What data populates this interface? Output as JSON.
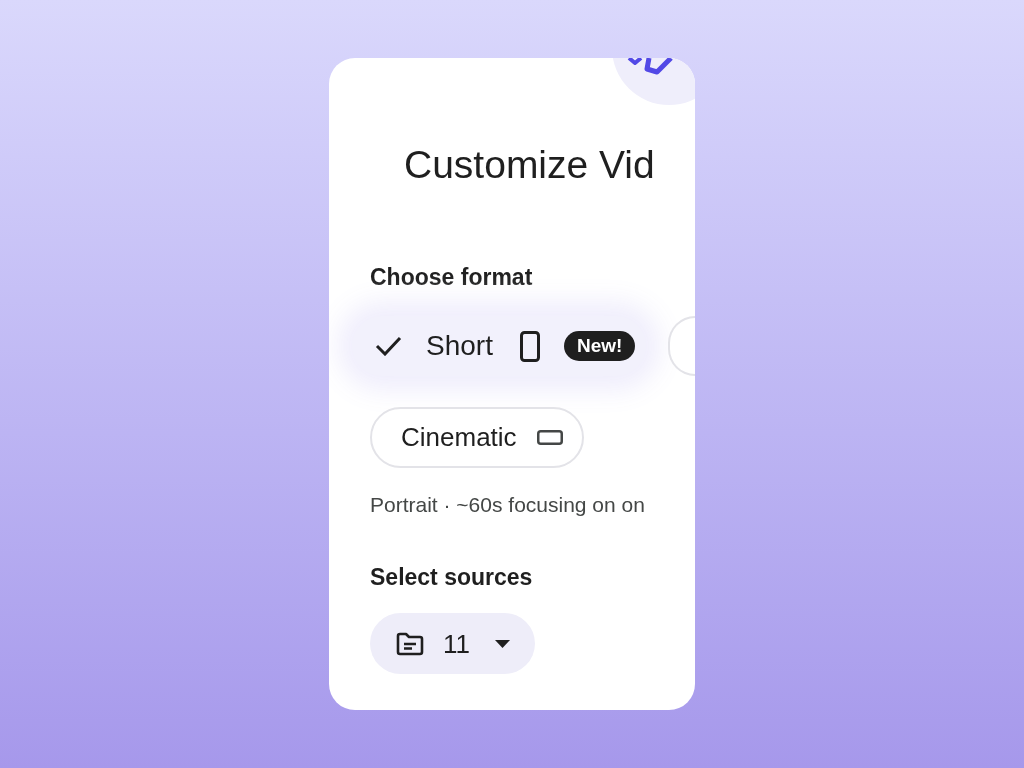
{
  "dialog": {
    "title": "Customize Vid"
  },
  "format_section": {
    "heading": "Choose format",
    "options": [
      {
        "label": "Short",
        "selected": true,
        "kind": "portrait",
        "badge": "New!"
      },
      {
        "selected": false
      },
      {
        "label": "Cinematic",
        "selected": false,
        "kind": "landscape"
      }
    ],
    "description": "Portrait · ~60s focusing on on"
  },
  "sources_section": {
    "heading": "Select sources",
    "count": "11"
  }
}
